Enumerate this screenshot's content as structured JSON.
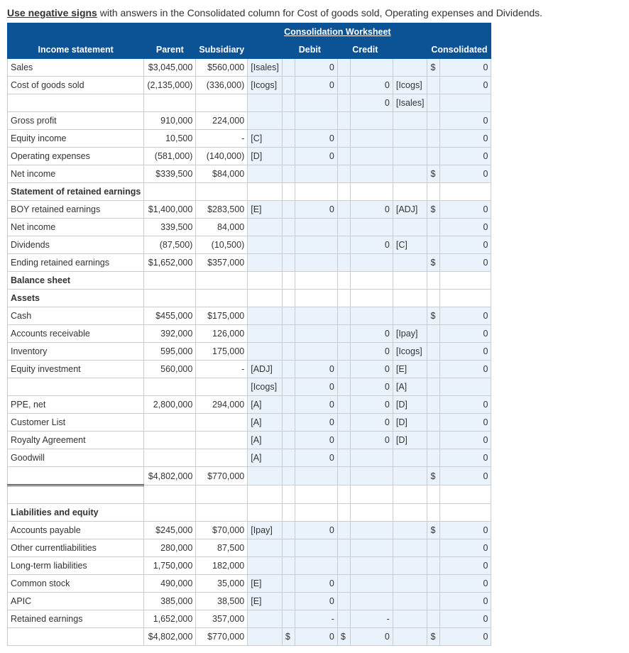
{
  "instructions_bold": "Use negative signs",
  "instructions_rest": " with answers in the Consolidated column for Cost of goods sold, Operating expenses and Dividends.",
  "worksheet_title": "Consolidation Worksheet",
  "headers": {
    "income_stmt": "Income statement",
    "parent": "Parent",
    "subsidiary": "Subsidiary",
    "debit": "Debit",
    "credit": "Credit",
    "consolidated": "Consolidated"
  },
  "sections": {
    "retained": "Statement of retained earnings",
    "balance": "Balance sheet",
    "assets": "Assets",
    "liab": "Liabilities and equity"
  },
  "rows": {
    "sales": {
      "label": "Sales",
      "parent": "$3,045,000",
      "sub": "$560,000",
      "dref": "[Isales]",
      "debit": "0",
      "cons_cur": "$",
      "cons": "0"
    },
    "cogs": {
      "label": "Cost of goods sold",
      "parent": "(2,135,000)",
      "sub": "(336,000)",
      "dref": "[Icogs]",
      "debit": "0",
      "credit": "0",
      "cref": "[Icogs]",
      "cons": "0"
    },
    "cogs2": {
      "credit": "0",
      "cref": "[Isales]"
    },
    "gross": {
      "label": "Gross profit",
      "parent": "910,000",
      "sub": "224,000",
      "cons": "0"
    },
    "eqinc": {
      "label": "Equity income",
      "parent": "10,500",
      "sub": "-",
      "dref": "[C]",
      "debit": "0",
      "cons": "0"
    },
    "opex": {
      "label": "Operating expenses",
      "parent": "(581,000)",
      "sub": "(140,000)",
      "dref": "[D]",
      "debit": "0",
      "cons": "0"
    },
    "netinc": {
      "label": "Net income",
      "parent": "$339,500",
      "sub": "$84,000",
      "cons_cur": "$",
      "cons": "0"
    },
    "boy": {
      "label": "BOY retained earnings",
      "parent": "$1,400,000",
      "sub": "$283,500",
      "dref": "[E]",
      "debit": "0",
      "credit": "0",
      "cref": "[ADJ]",
      "cons_cur": "$",
      "cons": "0"
    },
    "netinc2": {
      "label": "Net income",
      "parent": "339,500",
      "sub": "84,000",
      "cons": "0"
    },
    "div": {
      "label": "Dividends",
      "parent": "(87,500)",
      "sub": "(10,500)",
      "credit": "0",
      "cref": "[C]",
      "cons": "0"
    },
    "endre": {
      "label": "Ending retained earnings",
      "parent": "$1,652,000",
      "sub": "$357,000",
      "cons_cur": "$",
      "cons": "0"
    },
    "cash": {
      "label": "Cash",
      "parent": "$455,000",
      "sub": "$175,000",
      "cons_cur": "$",
      "cons": "0"
    },
    "ar": {
      "label": "Accounts receivable",
      "parent": "392,000",
      "sub": "126,000",
      "credit": "0",
      "cref": "[Ipay]",
      "cons": "0"
    },
    "inv": {
      "label": "Inventory",
      "parent": "595,000",
      "sub": "175,000",
      "credit": "0",
      "cref": "[Icogs]",
      "cons": "0"
    },
    "eqinv": {
      "label": "Equity investment",
      "parent": "560,000",
      "sub": "-",
      "dref": "[ADJ]",
      "debit": "0",
      "credit": "0",
      "cref": "[E]",
      "cons": "0"
    },
    "eqinv2": {
      "dref": "[Icogs]",
      "debit": "0",
      "credit": "0",
      "cref": "[A]"
    },
    "ppe": {
      "label": "PPE, net",
      "parent": "2,800,000",
      "sub": "294,000",
      "dref": "[A]",
      "debit": "0",
      "credit": "0",
      "cref": "[D]",
      "cons": "0"
    },
    "cust": {
      "label": "Customer List",
      "dref": "[A]",
      "debit": "0",
      "credit": "0",
      "cref": "[D]",
      "cons": "0"
    },
    "royal": {
      "label": "Royalty Agreement",
      "dref": "[A]",
      "debit": "0",
      "credit": "0",
      "cref": "[D]",
      "cons": "0"
    },
    "gw": {
      "label": "Goodwill",
      "dref": "[A]",
      "debit": "0",
      "cons": "0"
    },
    "atotal": {
      "parent": "$4,802,000",
      "sub": "$770,000",
      "cons_cur": "$",
      "cons": "0"
    },
    "ap": {
      "label": "Accounts payable",
      "parent": "$245,000",
      "sub": "$70,000",
      "dref": "[Ipay]",
      "debit": "0",
      "cons_cur": "$",
      "cons": "0"
    },
    "ocl": {
      "label": "Other currentliabilities",
      "parent": "280,000",
      "sub": "87,500",
      "cons": "0"
    },
    "ltl": {
      "label": "Long-term liabilities",
      "parent": "1,750,000",
      "sub": "182,000",
      "cons": "0"
    },
    "cs": {
      "label": "Common stock",
      "parent": "490,000",
      "sub": "35,000",
      "dref": "[E]",
      "debit": "0",
      "cons": "0"
    },
    "apic": {
      "label": "APIC",
      "parent": "385,000",
      "sub": "38,500",
      "dref": "[E]",
      "debit": "0",
      "cons": "0"
    },
    "re": {
      "label": "Retained earnings",
      "parent": "1,652,000",
      "sub": "357,000",
      "debit": "-",
      "credit": "-",
      "cons": "0"
    },
    "ltotal": {
      "parent": "$4,802,000",
      "sub": "$770,000",
      "dcur": "$",
      "debit": "0",
      "ccur": "$",
      "credit": "0",
      "cons_cur": "$",
      "cons": "0"
    }
  }
}
